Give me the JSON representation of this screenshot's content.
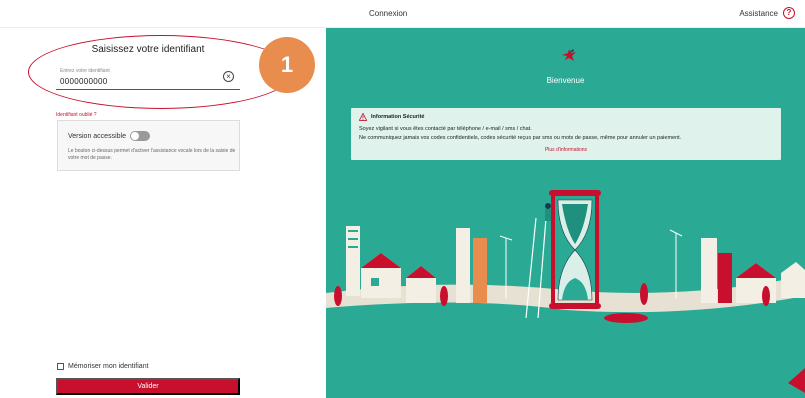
{
  "topbar": {
    "title": "Connexion",
    "help_label": "Assistance",
    "help_icon": "?"
  },
  "login": {
    "heading": "Saisissez votre identifiant",
    "input_label": "Entrez votre identifiant",
    "input_value": "0000000000",
    "clear_icon": "×",
    "forgot_link": "Identifiant oublié ?",
    "accessible_label": "Version accessible",
    "accessible_description": "Le bouton ci-dessus permet d'activer l'assistance vocale lors de la saisie de votre mot de passe.",
    "accessible_enabled": false,
    "remember_label": "Mémoriser mon identifiant",
    "remember_checked": false,
    "submit_label": "Valider"
  },
  "annotation": {
    "number": "1"
  },
  "welcome": {
    "title": "Bienvenue",
    "security_title": "Information Sécurité",
    "security_line1": "Soyez vigilant si vous êtes contacté par téléphone / e-mail / sms / chat.",
    "security_line2": "Ne communiquez jamais vos codes confidentiels, codes sécurité reçus par sms ou mots de passe, même pour annuler un paiement.",
    "security_link": "Plus d'informations"
  },
  "colors": {
    "brand_red": "#c8102e",
    "teal": "#2aa994",
    "annotation_orange": "#e98d4f"
  }
}
